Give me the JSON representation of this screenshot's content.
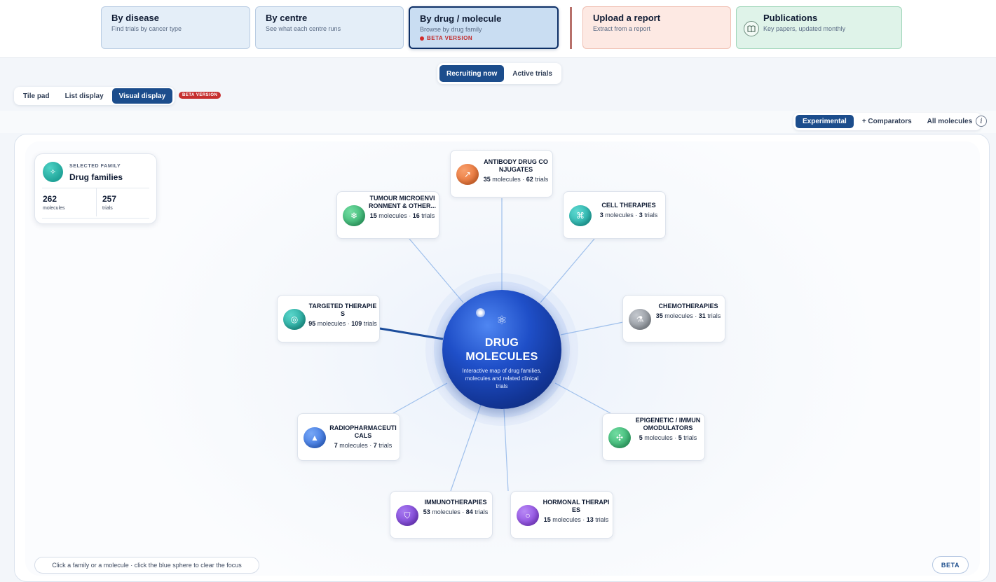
{
  "top_nav": {
    "by_disease": {
      "title": "By disease",
      "subtitle": "Find trials by cancer type"
    },
    "by_centre": {
      "title": "By centre",
      "subtitle": "See what each centre runs"
    },
    "by_drug": {
      "title": "By drug / molecule",
      "subtitle": "Browse by drug family",
      "beta": "BETA VERSION"
    },
    "upload": {
      "title": "Upload a report",
      "subtitle": "Extract from a report"
    },
    "publications": {
      "title": "Publications",
      "subtitle": "Key papers, updated monthly",
      "icon": "book-icon"
    }
  },
  "trial_status": {
    "options": [
      "Recruiting now",
      "Active trials"
    ],
    "selected": "Recruiting now"
  },
  "display_mode": {
    "options": [
      "Tile pad",
      "List display",
      "Visual display"
    ],
    "selected": "Visual display",
    "beta": "BETA VERSION"
  },
  "molecule_filter": {
    "options": [
      "Experimental",
      "+ Comparators",
      "All molecules"
    ],
    "selected": "Experimental",
    "info": "i"
  },
  "selected_family": {
    "label": "SELECTED FAMILY",
    "name": "Drug families",
    "molecules": "262",
    "molecules_label": "molecules",
    "trials": "257",
    "trials_label": "trials",
    "icon": "sparkle-icon"
  },
  "center": {
    "title_line1": "DRUG",
    "title_line2": "MOLECULES",
    "description": "Interactive map of drug families, molecules and related clinical trials",
    "icon": "atom-icon"
  },
  "families": [
    {
      "name": "ANTIBODY DRUG CONJUGATES",
      "molecules": "35",
      "trials": "62",
      "icon": "arrow-icon",
      "color": "#e86a2e",
      "glyph": "↗"
    },
    {
      "name": "CELL THERAPIES",
      "molecules": "3",
      "trials": "3",
      "icon": "cells-icon",
      "color": "#1ab3ad",
      "glyph": "⌘"
    },
    {
      "name": "CHEMOTHERAPIES",
      "molecules": "35",
      "trials": "31",
      "icon": "flask-icon",
      "color": "#8e949c",
      "glyph": "⚗"
    },
    {
      "name": "EPIGENETIC / IMMUNOMODULATORS",
      "molecules": "5",
      "trials": "5",
      "icon": "move-icon",
      "color": "#2fb56e",
      "glyph": "✣"
    },
    {
      "name": "HORMONAL THERAPIES",
      "molecules": "15",
      "trials": "13",
      "icon": "ring-icon",
      "color": "#8a3fe0",
      "glyph": "○"
    },
    {
      "name": "IMMUNOTHERAPIES",
      "molecules": "53",
      "trials": "84",
      "icon": "shield-icon",
      "color": "#7a3ad8",
      "glyph": "⛉"
    },
    {
      "name": "RADIOPHARMACEUTICALS",
      "molecules": "7",
      "trials": "7",
      "icon": "triangle-icon",
      "color": "#2f74e6",
      "glyph": "▲"
    },
    {
      "name": "TARGETED THERAPIES",
      "molecules": "95",
      "trials": "109",
      "icon": "target-icon",
      "color": "#14a89b",
      "glyph": "◎"
    },
    {
      "name": "TUMOUR MICROENVIRONMENT & OTHER...",
      "molecules": "15",
      "trials": "16",
      "icon": "snowflake-icon",
      "color": "#2fb56e",
      "glyph": "❄"
    }
  ],
  "stat_words": {
    "molecules": "molecules",
    "trials": "trials"
  },
  "hint": "Click a family or a molecule · click the blue sphere to clear the focus",
  "beta_button": "BETA"
}
